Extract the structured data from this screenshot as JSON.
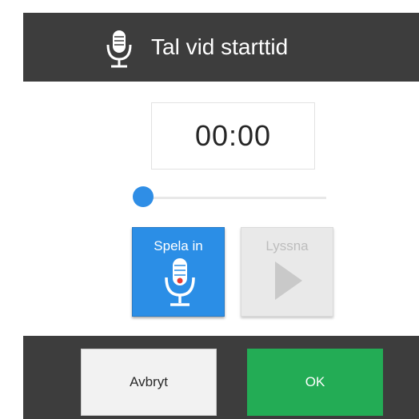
{
  "dialog": {
    "title": "Tal vid starttid",
    "header_icon": "microphone-icon",
    "time_display": "00:00",
    "playback_progress": 0,
    "record_button": {
      "label": "Spela in",
      "icon": "microphone-record-icon"
    },
    "listen_button": {
      "label": "Lyssna",
      "icon": "play-icon",
      "enabled": false
    },
    "cancel_button": {
      "label": "Avbryt"
    },
    "ok_button": {
      "label": "OK"
    }
  },
  "colors": {
    "header_bg": "#3d3d3d",
    "accent_blue": "#2b8ee6",
    "ok_green": "#23ac55",
    "record_dot": "#e53935",
    "disabled_gray": "#e9e9e9"
  }
}
